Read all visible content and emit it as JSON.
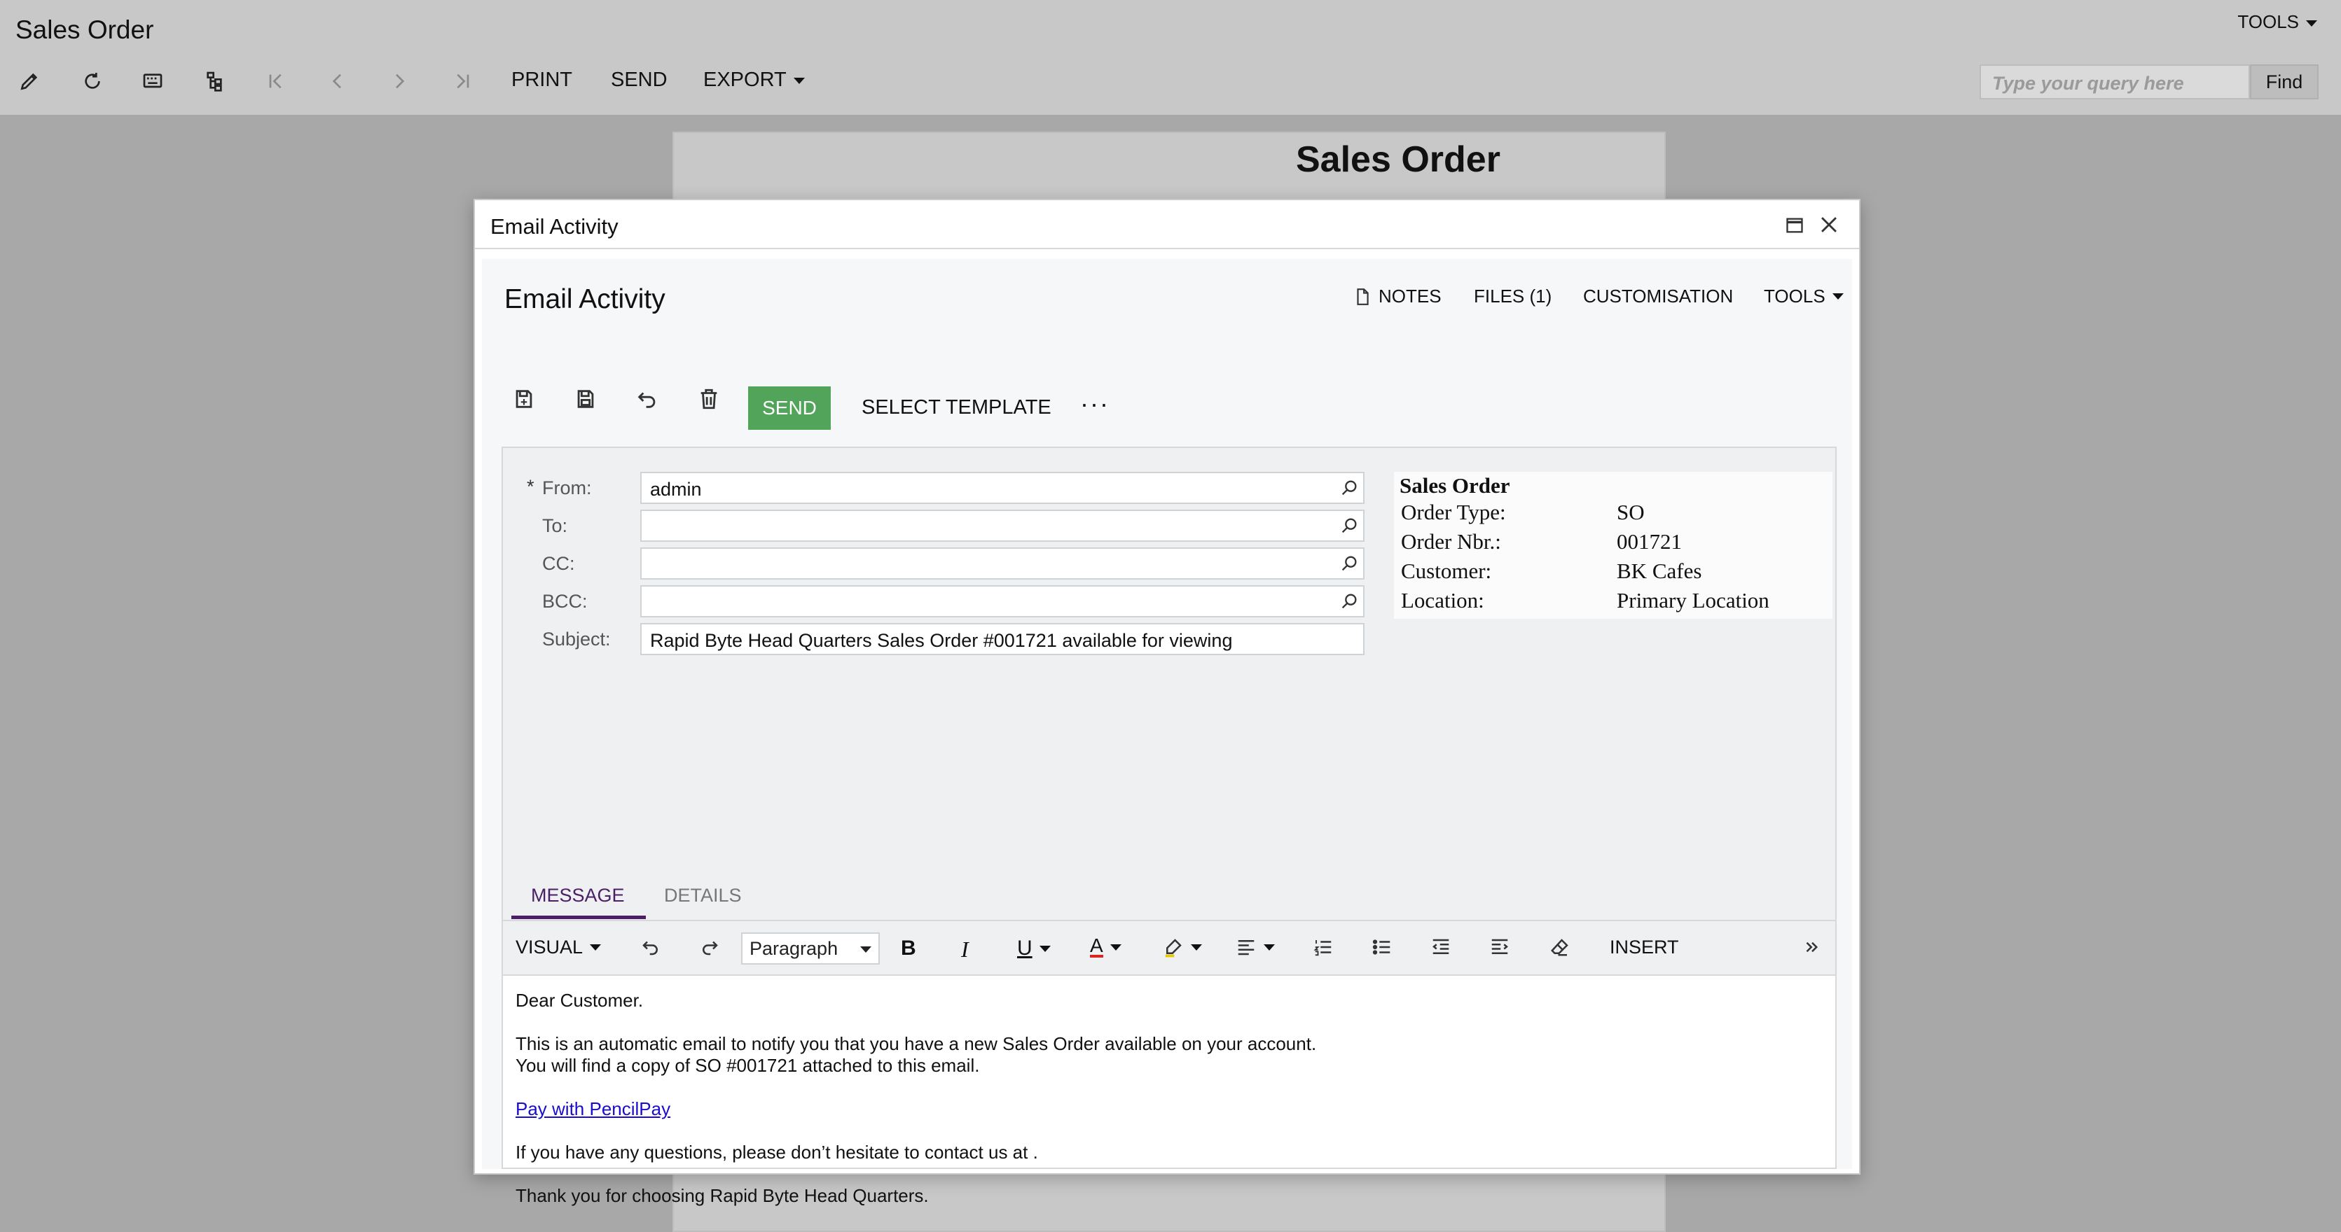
{
  "page": {
    "title": "Sales Order",
    "tools_label": "TOOLS",
    "toolbar": {
      "print_label": "PRINT",
      "send_label": "SEND",
      "export_label": "EXPORT"
    },
    "search": {
      "placeholder": "Type your query here",
      "find_label": "Find"
    },
    "document": {
      "title": "Sales Order"
    }
  },
  "modal": {
    "title": "Email Activity",
    "panel_title": "Email Activity",
    "links": {
      "notes": "NOTES",
      "files": "FILES (1)",
      "customisation": "CUSTOMISATION",
      "tools": "TOOLS"
    },
    "toolbar": {
      "send_label": "SEND",
      "select_template_label": "SELECT TEMPLATE",
      "more_label": "···"
    },
    "fields": {
      "required_mark": "*",
      "from_label": "From:",
      "from_value": "admin",
      "to_label": "To:",
      "to_value": "",
      "cc_label": "CC:",
      "cc_value": "",
      "bcc_label": "BCC:",
      "bcc_value": "",
      "subject_label": "Subject:",
      "subject_value": "Rapid Byte Head Quarters Sales Order #001721 available for viewing"
    },
    "info": {
      "heading": "Sales Order",
      "rows": [
        {
          "label": "Order Type:",
          "value": "SO"
        },
        {
          "label": "Order Nbr.:",
          "value": "001721"
        },
        {
          "label": "Customer:",
          "value": "BK Cafes"
        },
        {
          "label": "Location:",
          "value": "Primary Location"
        }
      ]
    },
    "tabs": {
      "message": "MESSAGE",
      "details": "DETAILS"
    },
    "editor_toolbar": {
      "mode": "VISUAL",
      "paragraph": "Paragraph",
      "insert": "INSERT"
    },
    "message": {
      "greeting": "Dear Customer.",
      "line1": "This is an automatic email to notify you that you have a new Sales Order available on your account.",
      "line2": "You will find a copy of SO #001721 attached to this email.",
      "link": "Pay with PencilPay",
      "line3": "If you have any questions, please don’t hesitate to contact us at .",
      "line4": "Thank you for choosing Rapid Byte Head Quarters."
    }
  },
  "colors": {
    "send_button": "#52a45a",
    "tab_active": "#4b1e66",
    "link": "#1a0dcc"
  }
}
